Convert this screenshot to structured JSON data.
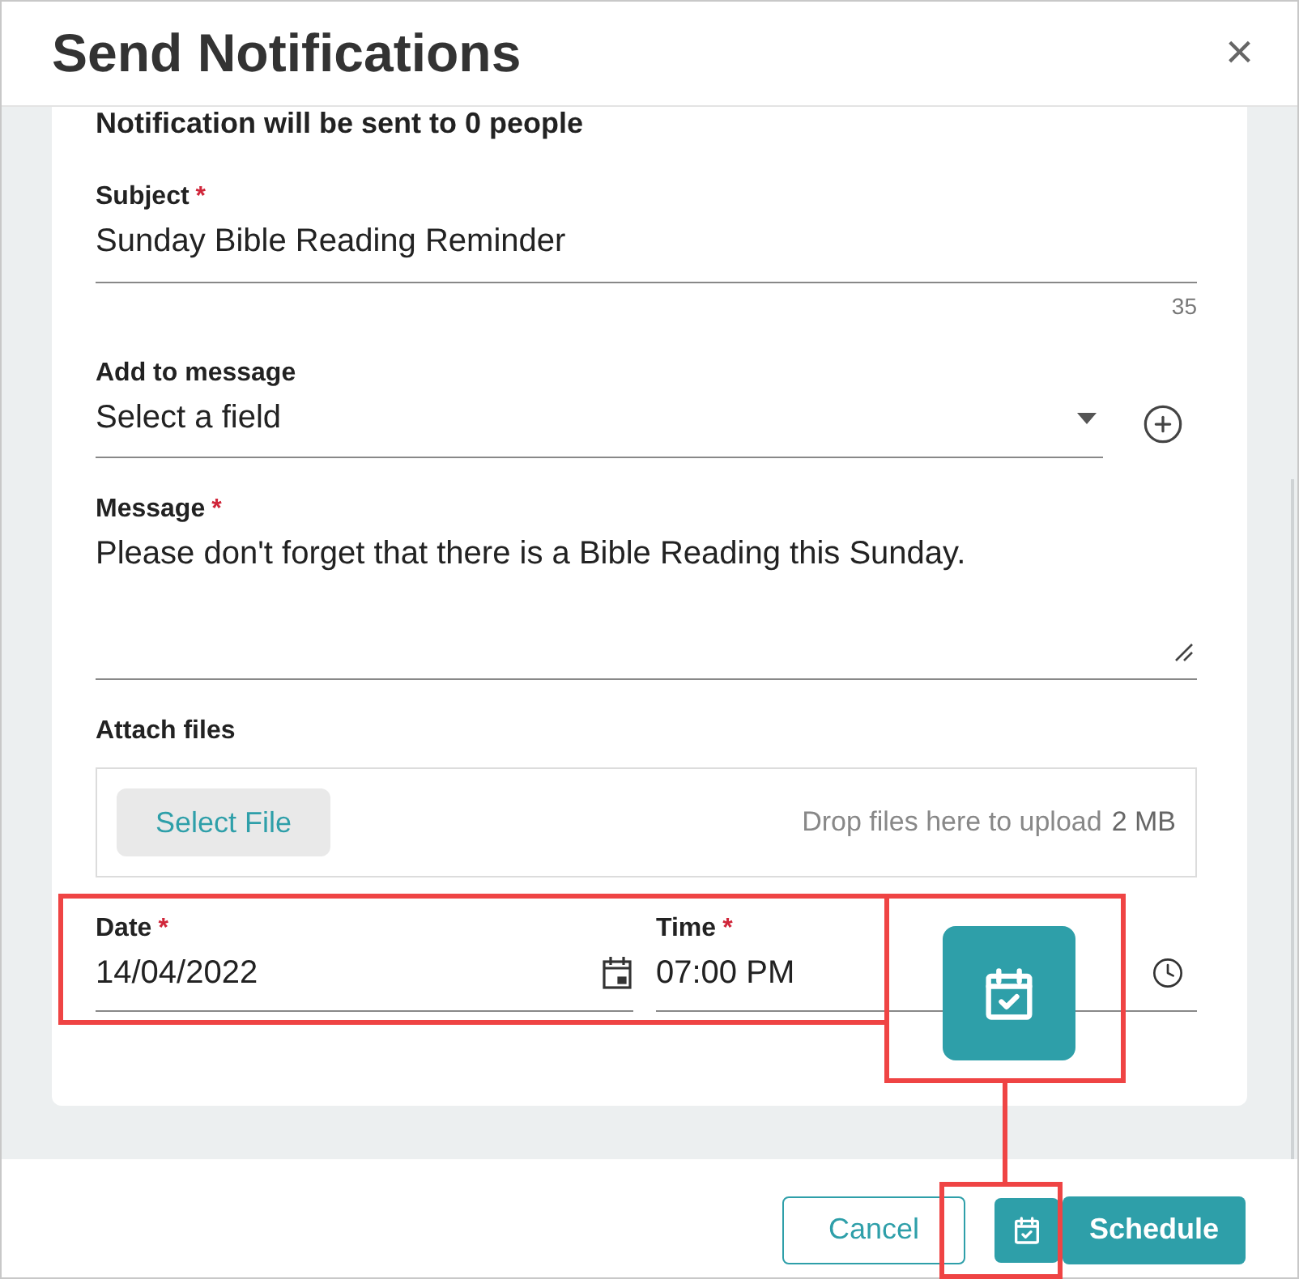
{
  "dialog": {
    "title": "Send Notifications",
    "close": "×"
  },
  "recipients_note": "Notification will be sent to 0 people",
  "subject": {
    "label": "Subject",
    "required_mark": "*",
    "value": "Sunday Bible Reading Reminder",
    "counter": "35"
  },
  "add_to_message": {
    "label": "Add to message",
    "placeholder": "Select a field"
  },
  "message": {
    "label": "Message",
    "required_mark": "*",
    "value": "Please don't forget that there is a Bible Reading this Sunday."
  },
  "attach": {
    "label": "Attach files",
    "button": "Select File",
    "hint": "Drop files here to upload",
    "max_size": "2 MB"
  },
  "date": {
    "label": "Date",
    "required_mark": "*",
    "value": "14/04/2022"
  },
  "time": {
    "label": "Time",
    "required_mark": "*",
    "value": "07:00 PM"
  },
  "footer": {
    "cancel": "Cancel",
    "schedule": "Schedule"
  }
}
